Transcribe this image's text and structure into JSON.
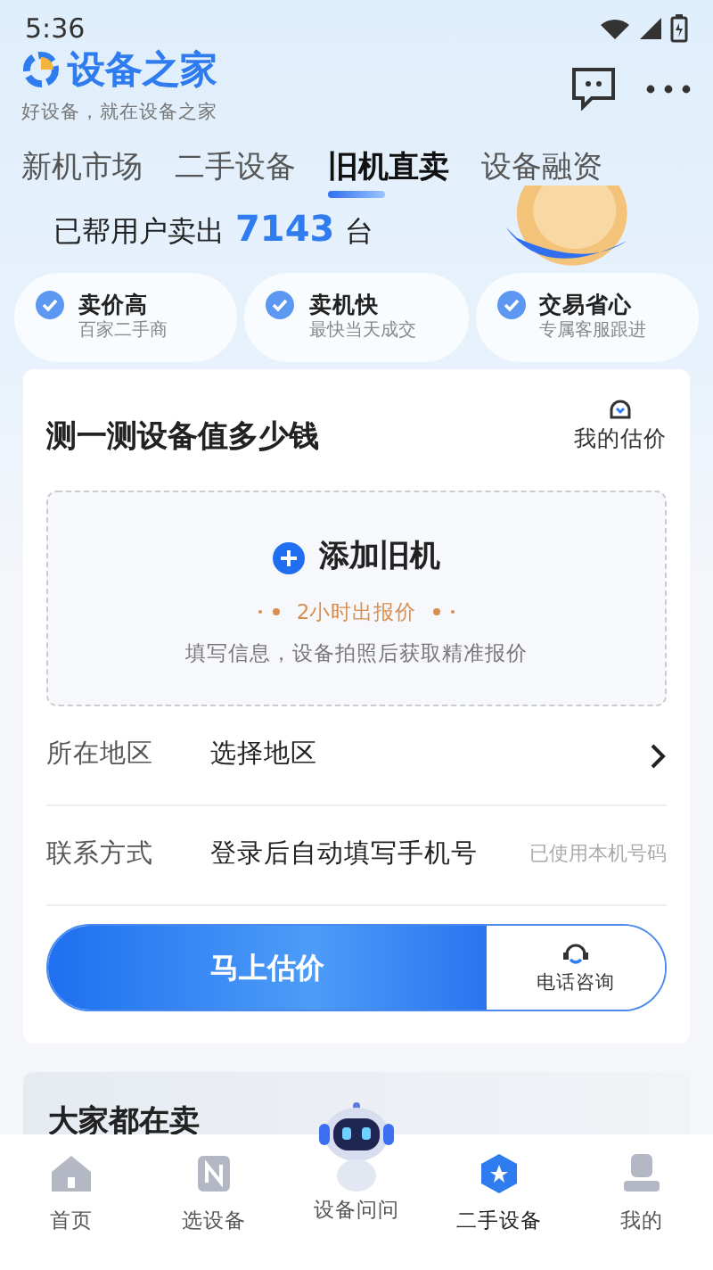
{
  "status_bar": {
    "time": "5:36"
  },
  "header": {
    "app_name": "设备之家",
    "slogan": "好设备，就在设备之家"
  },
  "tabs": [
    {
      "label": "新机市场",
      "selected": false
    },
    {
      "label": "二手设备",
      "selected": false
    },
    {
      "label": "旧机直卖",
      "selected": true
    },
    {
      "label": "设备融资",
      "selected": false
    }
  ],
  "banner": {
    "text_before": "已帮用户卖出",
    "count": "7143",
    "text_after": "台"
  },
  "features": [
    {
      "title": "卖价高",
      "subtitle": "百家二手商"
    },
    {
      "title": "卖机快",
      "subtitle": "最快当天成交"
    },
    {
      "title": "交易省心",
      "subtitle": "专属客服跟进"
    }
  ],
  "estimate_card": {
    "title": "测一测设备值多少钱",
    "my_estimates": "我的估价",
    "add_device": {
      "label": "添加旧机",
      "note": "2小时出报价",
      "hint": "填写信息，设备拍照后获取精准报价"
    },
    "fields": [
      {
        "label": "所在地区",
        "value": "选择地区",
        "kind": "select"
      },
      {
        "label": "联系方式",
        "value": "登录后自动填写手机号",
        "aside": "已使用本机号码",
        "kind": "text"
      }
    ],
    "primary_button": "马上估价",
    "phone_button": "电话咨询"
  },
  "selling_section": {
    "title": "大家都在卖"
  },
  "bottom_nav": [
    {
      "label": "首页",
      "selected": false,
      "kind": "home"
    },
    {
      "label": "选设备",
      "selected": false,
      "kind": "pick"
    },
    {
      "label": "设备问问",
      "selected": false,
      "kind": "robot"
    },
    {
      "label": "二手设备",
      "selected": true,
      "kind": "used"
    },
    {
      "label": "我的",
      "selected": false,
      "kind": "me"
    }
  ]
}
